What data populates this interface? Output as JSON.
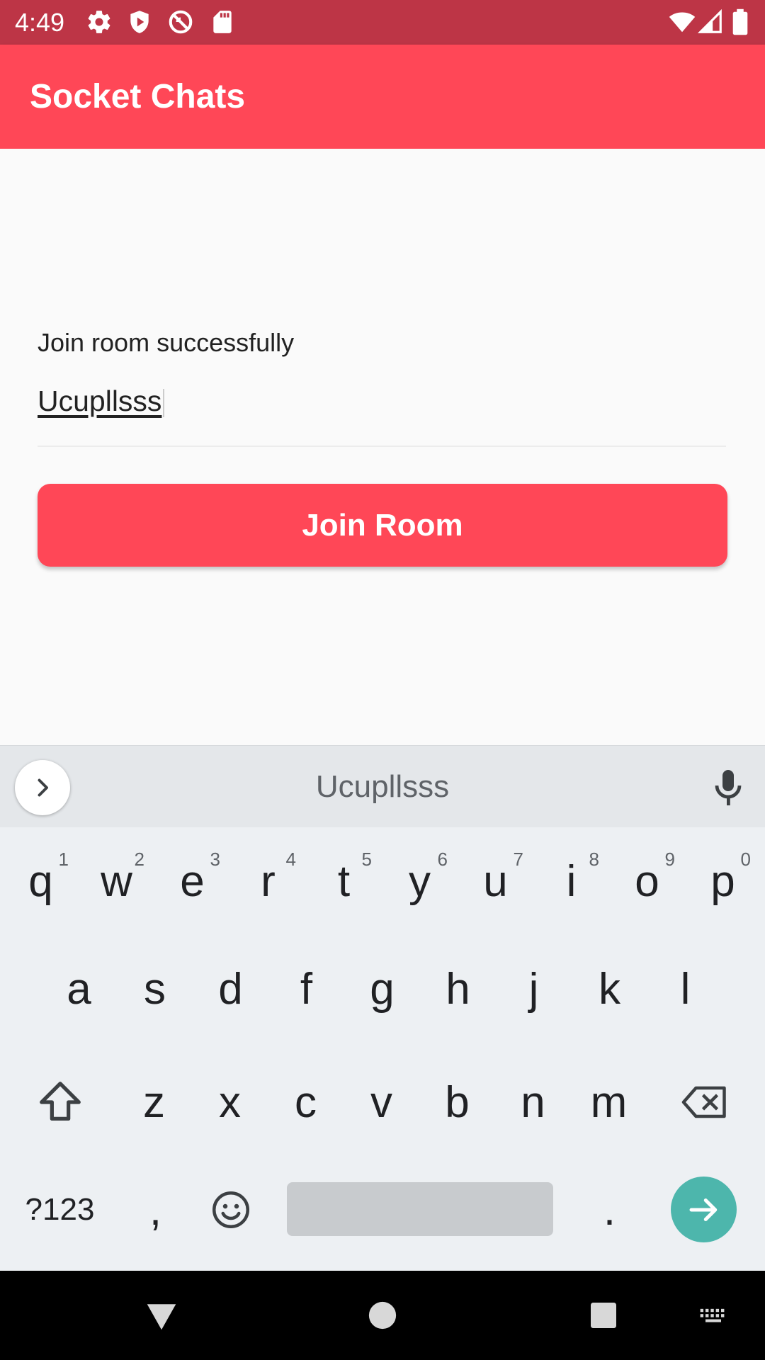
{
  "status_bar": {
    "time": "4:49",
    "left_icons": [
      "gear-icon",
      "shield-icon",
      "no-sim-icon",
      "sd-card-icon"
    ],
    "right_icons": [
      "wifi-icon",
      "signal-icon",
      "battery-icon"
    ]
  },
  "app_bar": {
    "title": "Socket Chats"
  },
  "main": {
    "status_label": "Join room successfully",
    "room_input_value": "Ucupllsss",
    "join_button_label": "Join Room"
  },
  "colors": {
    "status_bar": "#bd3546",
    "primary": "#ff4757",
    "enter_key": "#4db6ac"
  },
  "keyboard": {
    "suggestion": "Ucupllsss",
    "row1": [
      {
        "key": "q",
        "hint": "1"
      },
      {
        "key": "w",
        "hint": "2"
      },
      {
        "key": "e",
        "hint": "3"
      },
      {
        "key": "r",
        "hint": "4"
      },
      {
        "key": "t",
        "hint": "5"
      },
      {
        "key": "y",
        "hint": "6"
      },
      {
        "key": "u",
        "hint": "7"
      },
      {
        "key": "i",
        "hint": "8"
      },
      {
        "key": "o",
        "hint": "9"
      },
      {
        "key": "p",
        "hint": "0"
      }
    ],
    "row2": [
      "a",
      "s",
      "d",
      "f",
      "g",
      "h",
      "j",
      "k",
      "l"
    ],
    "row3": [
      "z",
      "x",
      "c",
      "v",
      "b",
      "n",
      "m"
    ],
    "symbols_label": "?123",
    "comma_label": ",",
    "period_label": "."
  },
  "nav_bar": {
    "icons": [
      "back-icon",
      "home-icon",
      "recents-icon",
      "keyboard-switch-icon"
    ]
  }
}
